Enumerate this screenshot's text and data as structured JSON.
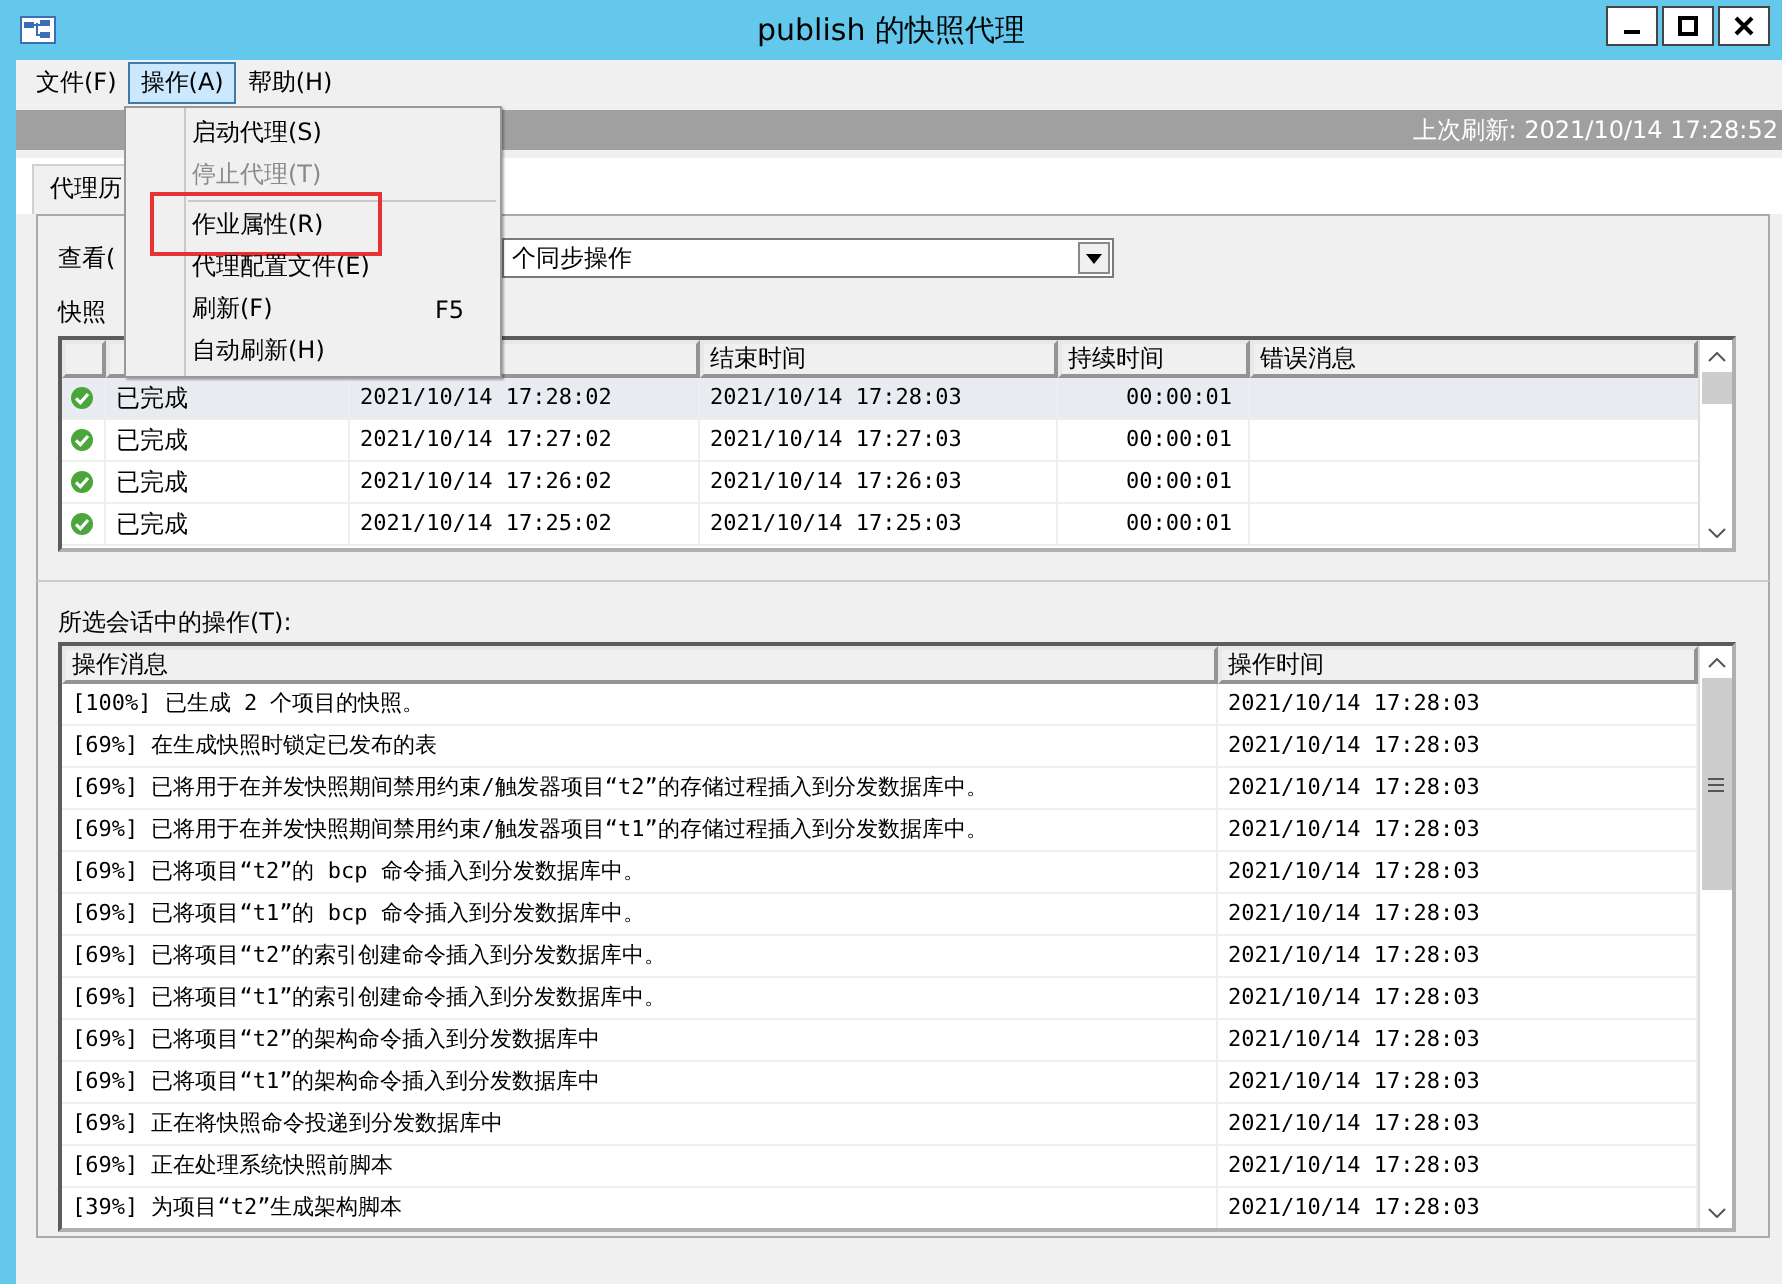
{
  "window": {
    "title": "publish 的快照代理"
  },
  "menubar": [
    {
      "label": "文件(F)",
      "selected": false
    },
    {
      "label": "操作(A)",
      "selected": true
    },
    {
      "label": "帮助(H)",
      "selected": false
    }
  ],
  "menu": [
    {
      "kind": "item",
      "label": "启动代理(S)",
      "disabled": false,
      "highlighted": false
    },
    {
      "kind": "item",
      "label": "停止代理(T)",
      "disabled": true,
      "highlighted": false
    },
    {
      "kind": "separator"
    },
    {
      "kind": "item",
      "label": "作业属性(R)",
      "disabled": false,
      "highlighted": true
    },
    {
      "kind": "item",
      "label": "代理配置文件(E)",
      "disabled": false,
      "highlighted": false
    },
    {
      "kind": "item",
      "label": "刷新(F)",
      "shortcut": "F5",
      "disabled": false,
      "highlighted": false
    },
    {
      "kind": "item",
      "label": "自动刷新(H)",
      "disabled": false,
      "highlighted": false
    }
  ],
  "last_refresh": "上次刷新: 2021/10/14 17:28:52",
  "tab": {
    "label": "代理历"
  },
  "view": {
    "label": "查看(",
    "value": "个同步操作"
  },
  "sessions": {
    "label": "快照",
    "columns": [
      "结束时间",
      "持续时间",
      "错误消息"
    ],
    "rows": [
      {
        "status": "已完成",
        "start": "2021/10/14 17:28:02",
        "end": "2021/10/14 17:28:03",
        "duration": "00:00:01",
        "selected": true
      },
      {
        "status": "已完成",
        "start": "2021/10/14 17:27:02",
        "end": "2021/10/14 17:27:03",
        "duration": "00:00:01",
        "selected": false
      },
      {
        "status": "已完成",
        "start": "2021/10/14 17:26:02",
        "end": "2021/10/14 17:26:03",
        "duration": "00:00:01",
        "selected": false
      },
      {
        "status": "已完成",
        "start": "2021/10/14 17:25:02",
        "end": "2021/10/14 17:25:03",
        "duration": "00:00:01",
        "selected": false
      }
    ]
  },
  "actions": {
    "label": "所选会话中的操作(T):",
    "columns": [
      "操作消息",
      "操作时间"
    ],
    "rows": [
      [
        "[100%] 已生成 2 个项目的快照。",
        "2021/10/14 17:28:03"
      ],
      [
        "[69%] 在生成快照时锁定已发布的表",
        "2021/10/14 17:28:03"
      ],
      [
        "[69%] 已将用于在并发快照期间禁用约束/触发器项目“t2”的存储过程插入到分发数据库中。",
        "2021/10/14 17:28:03"
      ],
      [
        "[69%] 已将用于在并发快照期间禁用约束/触发器项目“t1”的存储过程插入到分发数据库中。",
        "2021/10/14 17:28:03"
      ],
      [
        "[69%] 已将项目“t2”的 bcp 命令插入到分发数据库中。",
        "2021/10/14 17:28:03"
      ],
      [
        "[69%] 已将项目“t1”的 bcp 命令插入到分发数据库中。",
        "2021/10/14 17:28:03"
      ],
      [
        "[69%] 已将项目“t2”的索引创建命令插入到分发数据库中。",
        "2021/10/14 17:28:03"
      ],
      [
        "[69%] 已将项目“t1”的索引创建命令插入到分发数据库中。",
        "2021/10/14 17:28:03"
      ],
      [
        "[69%] 已将项目“t2”的架构命令插入到分发数据库中",
        "2021/10/14 17:28:03"
      ],
      [
        "[69%] 已将项目“t1”的架构命令插入到分发数据库中",
        "2021/10/14 17:28:03"
      ],
      [
        "[69%] 正在将快照命令投递到分发数据库中",
        "2021/10/14 17:28:03"
      ],
      [
        "[69%] 正在处理系统快照前脚本",
        "2021/10/14 17:28:03"
      ],
      [
        "[39%] 为项目“t2”生成架构脚本",
        "2021/10/14 17:28:03"
      ]
    ]
  }
}
